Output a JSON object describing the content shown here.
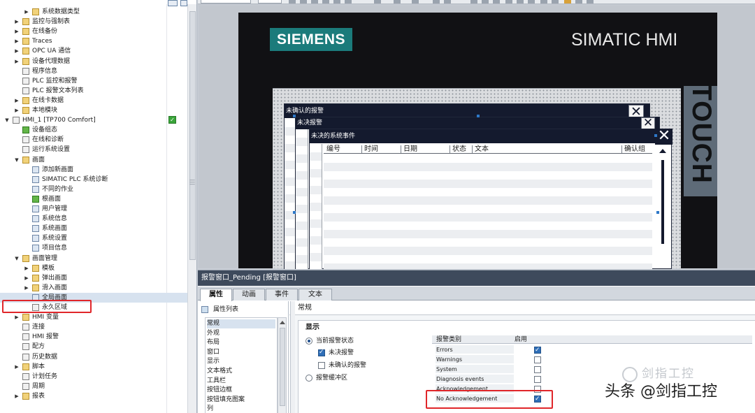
{
  "project_tree": {
    "items": [
      {
        "label": "系统数据类型",
        "level": 3,
        "icon": "folder-icon",
        "arrow": "right"
      },
      {
        "label": "监控与强制表",
        "level": 2,
        "icon": "folder-icon",
        "arrow": "right"
      },
      {
        "label": "在线备份",
        "level": 2,
        "icon": "folder-icon",
        "arrow": "right"
      },
      {
        "label": "Traces",
        "level": 2,
        "icon": "folder-icon",
        "arrow": "right"
      },
      {
        "label": "OPC UA 通信",
        "level": 2,
        "icon": "folder-icon",
        "arrow": "right"
      },
      {
        "label": "设备代理数据",
        "level": 2,
        "icon": "folder-icon",
        "arrow": "right"
      },
      {
        "label": "程序信息",
        "level": 2,
        "icon": "document-icon",
        "arrow": ""
      },
      {
        "label": "PLC 监控和报警",
        "level": 2,
        "icon": "document-icon",
        "arrow": ""
      },
      {
        "label": "PLC 报警文本列表",
        "level": 2,
        "icon": "document-icon",
        "arrow": ""
      },
      {
        "label": "在线卡数据",
        "level": 2,
        "icon": "folder-icon",
        "arrow": "right"
      },
      {
        "label": "本地模块",
        "level": 2,
        "icon": "folder-icon",
        "arrow": "right"
      },
      {
        "label": "HMI_1 [TP700 Comfort]",
        "level": 1,
        "icon": "hmi-device-icon",
        "arrow": "down"
      },
      {
        "label": "设备组态",
        "level": 2,
        "icon": "device-config-icon",
        "arrow": ""
      },
      {
        "label": "在线和诊断",
        "level": 2,
        "icon": "diagnostics-icon",
        "arrow": ""
      },
      {
        "label": "运行系统设置",
        "level": 2,
        "icon": "runtime-settings-icon",
        "arrow": ""
      },
      {
        "label": "画面",
        "level": 2,
        "icon": "folder-icon",
        "arrow": "down"
      },
      {
        "label": "添加新画面",
        "level": 3,
        "icon": "add-screen-icon",
        "arrow": ""
      },
      {
        "label": "SIMATIC PLC 系统诊断",
        "level": 3,
        "icon": "screen-icon",
        "arrow": ""
      },
      {
        "label": "不同的作业",
        "level": 3,
        "icon": "screen-icon",
        "arrow": ""
      },
      {
        "label": "根画面",
        "level": 3,
        "icon": "root-screen-icon",
        "arrow": ""
      },
      {
        "label": "用户管理",
        "level": 3,
        "icon": "screen-icon",
        "arrow": ""
      },
      {
        "label": "系统信息",
        "level": 3,
        "icon": "screen-icon",
        "arrow": ""
      },
      {
        "label": "系统画面",
        "level": 3,
        "icon": "screen-icon",
        "arrow": ""
      },
      {
        "label": "系统设置",
        "level": 3,
        "icon": "screen-icon",
        "arrow": ""
      },
      {
        "label": "项目信息",
        "level": 3,
        "icon": "screen-icon",
        "arrow": ""
      },
      {
        "label": "画面管理",
        "level": 2,
        "icon": "folder-icon",
        "arrow": "down"
      },
      {
        "label": "模板",
        "level": 3,
        "icon": "folder-icon",
        "arrow": "right"
      },
      {
        "label": "弹出画面",
        "level": 3,
        "icon": "folder-icon",
        "arrow": "right"
      },
      {
        "label": "滑入画面",
        "level": 3,
        "icon": "folder-icon",
        "arrow": "right"
      },
      {
        "label": "全局画面",
        "level": 3,
        "icon": "global-screen-icon",
        "arrow": "",
        "selected": true
      },
      {
        "label": "永久区域",
        "level": 3,
        "icon": "permanent-area-icon",
        "arrow": ""
      },
      {
        "label": "HMI 变量",
        "level": 2,
        "icon": "folder-icon",
        "arrow": "right"
      },
      {
        "label": "连接",
        "level": 2,
        "icon": "connection-icon",
        "arrow": ""
      },
      {
        "label": "HMI 报警",
        "level": 2,
        "icon": "alarm-icon",
        "arrow": ""
      },
      {
        "label": "配方",
        "level": 2,
        "icon": "recipe-icon",
        "arrow": ""
      },
      {
        "label": "历史数据",
        "level": 2,
        "icon": "historical-data-icon",
        "arrow": ""
      },
      {
        "label": "脚本",
        "level": 2,
        "icon": "folder-icon",
        "arrow": "right"
      },
      {
        "label": "计划任务",
        "level": 2,
        "icon": "scheduler-icon",
        "arrow": ""
      },
      {
        "label": "周期",
        "level": 2,
        "icon": "cycle-icon",
        "arrow": ""
      },
      {
        "label": "报表",
        "level": 2,
        "icon": "folder-icon",
        "arrow": "right"
      }
    ]
  },
  "hmi_screen": {
    "brand": "SIEMENS",
    "product": "SIMATIC HMI",
    "side_label": "TOUCH",
    "alarm_windows": [
      {
        "title": "未确认的报警",
        "close": "✕"
      },
      {
        "title": "未决报警",
        "close": "✕"
      },
      {
        "title": "未决的系统事件",
        "close": "✕"
      }
    ],
    "columns": [
      "编号",
      "时间",
      "日期",
      "状态",
      "文本",
      "确认组"
    ]
  },
  "properties": {
    "title": "报警窗口_Pending [报警窗口]",
    "tabs": [
      "属性",
      "动画",
      "事件",
      "文本"
    ],
    "active_tab": "属性",
    "list_header": "属性列表",
    "nav_items": [
      "常规",
      "外观",
      "布局",
      "窗口",
      "显示",
      "文本格式",
      "工具栏",
      "按钮边框",
      "按钮填充图案",
      "列"
    ],
    "section_title": "常规",
    "display": {
      "header": "显示",
      "radio_current": "当前报警状态",
      "check_pending": "未决报警",
      "check_unack": "未确认的报警",
      "radio_buffer": "报警缓冲区"
    },
    "category_table": {
      "col_category": "报警类别",
      "col_enabled": "启用",
      "rows": [
        {
          "name": "Errors",
          "enabled": true
        },
        {
          "name": "Warnings",
          "enabled": false
        },
        {
          "name": "System",
          "enabled": false
        },
        {
          "name": "Diagnosis events",
          "enabled": false
        },
        {
          "name": "Acknowledgement",
          "enabled": false
        },
        {
          "name": "No Acknowledgement",
          "enabled": true
        }
      ]
    }
  },
  "watermark": {
    "small": "剑指工控",
    "big": "头条 @剑指工控"
  }
}
